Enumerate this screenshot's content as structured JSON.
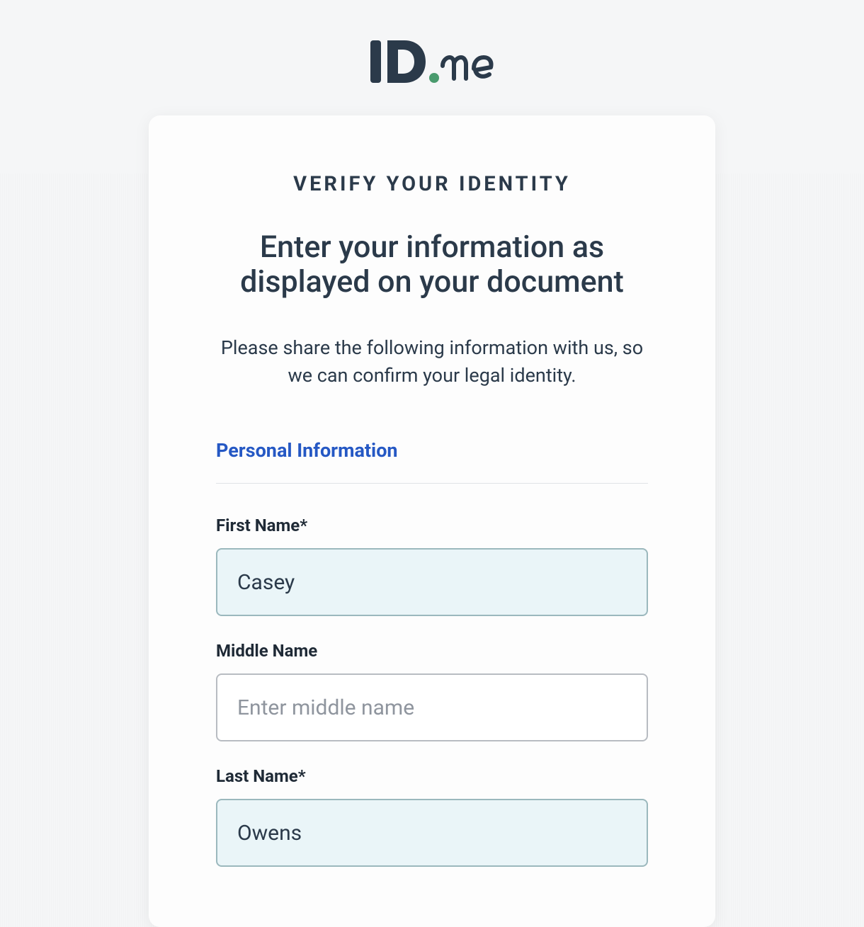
{
  "logo": {
    "brand_text": "ID.me"
  },
  "header": {
    "eyebrow": "VERIFY YOUR IDENTITY",
    "headline": "Enter your information as displayed on your document",
    "subtext": "Please share the following information with us, so we can confirm your legal identity."
  },
  "section": {
    "title": "Personal Information"
  },
  "form": {
    "first_name": {
      "label": "First Name*",
      "value": "Casey",
      "placeholder": ""
    },
    "middle_name": {
      "label": "Middle Name",
      "value": "",
      "placeholder": "Enter middle name"
    },
    "last_name": {
      "label": "Last Name*",
      "value": "Owens",
      "placeholder": ""
    }
  }
}
